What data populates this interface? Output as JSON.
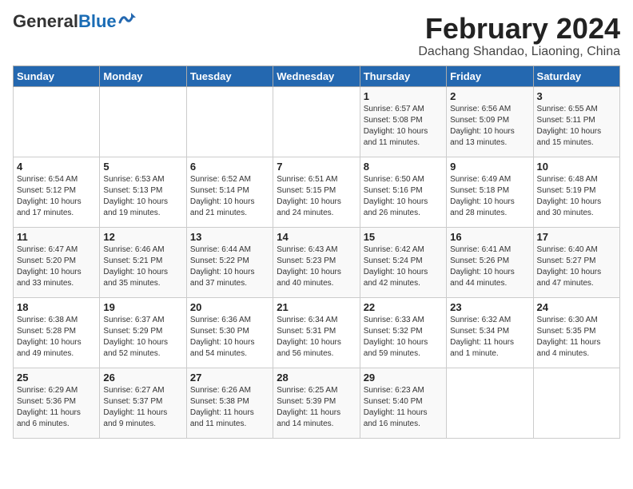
{
  "header": {
    "logo_general": "General",
    "logo_blue": "Blue",
    "month_title": "February 2024",
    "subtitle": "Dachang Shandao, Liaoning, China"
  },
  "weekdays": [
    "Sunday",
    "Monday",
    "Tuesday",
    "Wednesday",
    "Thursday",
    "Friday",
    "Saturday"
  ],
  "weeks": [
    [
      {
        "day": "",
        "info": ""
      },
      {
        "day": "",
        "info": ""
      },
      {
        "day": "",
        "info": ""
      },
      {
        "day": "",
        "info": ""
      },
      {
        "day": "1",
        "info": "Sunrise: 6:57 AM\nSunset: 5:08 PM\nDaylight: 10 hours\nand 11 minutes."
      },
      {
        "day": "2",
        "info": "Sunrise: 6:56 AM\nSunset: 5:09 PM\nDaylight: 10 hours\nand 13 minutes."
      },
      {
        "day": "3",
        "info": "Sunrise: 6:55 AM\nSunset: 5:11 PM\nDaylight: 10 hours\nand 15 minutes."
      }
    ],
    [
      {
        "day": "4",
        "info": "Sunrise: 6:54 AM\nSunset: 5:12 PM\nDaylight: 10 hours\nand 17 minutes."
      },
      {
        "day": "5",
        "info": "Sunrise: 6:53 AM\nSunset: 5:13 PM\nDaylight: 10 hours\nand 19 minutes."
      },
      {
        "day": "6",
        "info": "Sunrise: 6:52 AM\nSunset: 5:14 PM\nDaylight: 10 hours\nand 21 minutes."
      },
      {
        "day": "7",
        "info": "Sunrise: 6:51 AM\nSunset: 5:15 PM\nDaylight: 10 hours\nand 24 minutes."
      },
      {
        "day": "8",
        "info": "Sunrise: 6:50 AM\nSunset: 5:16 PM\nDaylight: 10 hours\nand 26 minutes."
      },
      {
        "day": "9",
        "info": "Sunrise: 6:49 AM\nSunset: 5:18 PM\nDaylight: 10 hours\nand 28 minutes."
      },
      {
        "day": "10",
        "info": "Sunrise: 6:48 AM\nSunset: 5:19 PM\nDaylight: 10 hours\nand 30 minutes."
      }
    ],
    [
      {
        "day": "11",
        "info": "Sunrise: 6:47 AM\nSunset: 5:20 PM\nDaylight: 10 hours\nand 33 minutes."
      },
      {
        "day": "12",
        "info": "Sunrise: 6:46 AM\nSunset: 5:21 PM\nDaylight: 10 hours\nand 35 minutes."
      },
      {
        "day": "13",
        "info": "Sunrise: 6:44 AM\nSunset: 5:22 PM\nDaylight: 10 hours\nand 37 minutes."
      },
      {
        "day": "14",
        "info": "Sunrise: 6:43 AM\nSunset: 5:23 PM\nDaylight: 10 hours\nand 40 minutes."
      },
      {
        "day": "15",
        "info": "Sunrise: 6:42 AM\nSunset: 5:24 PM\nDaylight: 10 hours\nand 42 minutes."
      },
      {
        "day": "16",
        "info": "Sunrise: 6:41 AM\nSunset: 5:26 PM\nDaylight: 10 hours\nand 44 minutes."
      },
      {
        "day": "17",
        "info": "Sunrise: 6:40 AM\nSunset: 5:27 PM\nDaylight: 10 hours\nand 47 minutes."
      }
    ],
    [
      {
        "day": "18",
        "info": "Sunrise: 6:38 AM\nSunset: 5:28 PM\nDaylight: 10 hours\nand 49 minutes."
      },
      {
        "day": "19",
        "info": "Sunrise: 6:37 AM\nSunset: 5:29 PM\nDaylight: 10 hours\nand 52 minutes."
      },
      {
        "day": "20",
        "info": "Sunrise: 6:36 AM\nSunset: 5:30 PM\nDaylight: 10 hours\nand 54 minutes."
      },
      {
        "day": "21",
        "info": "Sunrise: 6:34 AM\nSunset: 5:31 PM\nDaylight: 10 hours\nand 56 minutes."
      },
      {
        "day": "22",
        "info": "Sunrise: 6:33 AM\nSunset: 5:32 PM\nDaylight: 10 hours\nand 59 minutes."
      },
      {
        "day": "23",
        "info": "Sunrise: 6:32 AM\nSunset: 5:34 PM\nDaylight: 11 hours\nand 1 minute."
      },
      {
        "day": "24",
        "info": "Sunrise: 6:30 AM\nSunset: 5:35 PM\nDaylight: 11 hours\nand 4 minutes."
      }
    ],
    [
      {
        "day": "25",
        "info": "Sunrise: 6:29 AM\nSunset: 5:36 PM\nDaylight: 11 hours\nand 6 minutes."
      },
      {
        "day": "26",
        "info": "Sunrise: 6:27 AM\nSunset: 5:37 PM\nDaylight: 11 hours\nand 9 minutes."
      },
      {
        "day": "27",
        "info": "Sunrise: 6:26 AM\nSunset: 5:38 PM\nDaylight: 11 hours\nand 11 minutes."
      },
      {
        "day": "28",
        "info": "Sunrise: 6:25 AM\nSunset: 5:39 PM\nDaylight: 11 hours\nand 14 minutes."
      },
      {
        "day": "29",
        "info": "Sunrise: 6:23 AM\nSunset: 5:40 PM\nDaylight: 11 hours\nand 16 minutes."
      },
      {
        "day": "",
        "info": ""
      },
      {
        "day": "",
        "info": ""
      }
    ]
  ]
}
